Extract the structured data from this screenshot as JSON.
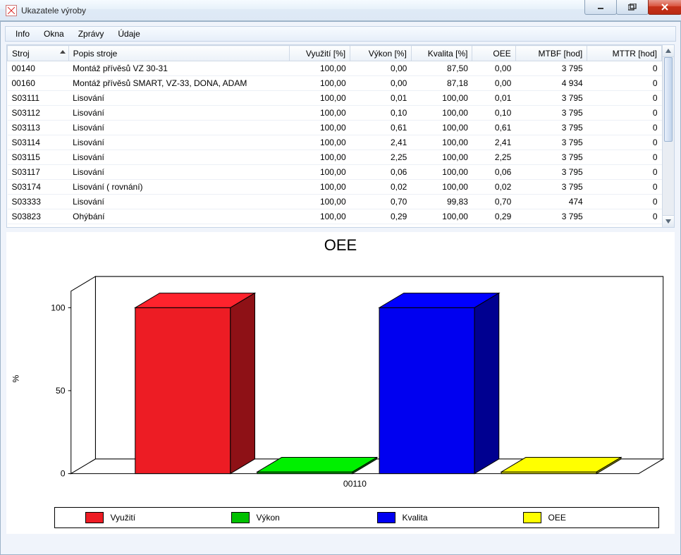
{
  "window": {
    "title": "Ukazatele výroby"
  },
  "menu": {
    "items": [
      "Info",
      "Okna",
      "Zprávy",
      "Údaje"
    ]
  },
  "table": {
    "columns": {
      "stroj": "Stroj",
      "popis": "Popis stroje",
      "vyuziti": "Využití [%]",
      "vykon": "Výkon [%]",
      "kvalita": "Kvalita [%]",
      "oee": "OEE",
      "mtbf": "MTBF [hod]",
      "mttr": "MTTR [hod]"
    },
    "rows": [
      {
        "stroj": "00140",
        "popis": "Montáž přívěsů VZ 30-31",
        "vyuziti": "100,00",
        "vykon": "0,00",
        "kvalita": "87,50",
        "oee": "0,00",
        "mtbf": "3 795",
        "mttr": "0"
      },
      {
        "stroj": "00160",
        "popis": "Montáž přívěsů SMART, VZ-33, DONA, ADAM",
        "vyuziti": "100,00",
        "vykon": "0,00",
        "kvalita": "87,18",
        "oee": "0,00",
        "mtbf": "4 934",
        "mttr": "0"
      },
      {
        "stroj": "S03111",
        "popis": "Lisování",
        "vyuziti": "100,00",
        "vykon": "0,01",
        "kvalita": "100,00",
        "oee": "0,01",
        "mtbf": "3 795",
        "mttr": "0"
      },
      {
        "stroj": "S03112",
        "popis": "Lisování",
        "vyuziti": "100,00",
        "vykon": "0,10",
        "kvalita": "100,00",
        "oee": "0,10",
        "mtbf": "3 795",
        "mttr": "0"
      },
      {
        "stroj": "S03113",
        "popis": "Lisování",
        "vyuziti": "100,00",
        "vykon": "0,61",
        "kvalita": "100,00",
        "oee": "0,61",
        "mtbf": "3 795",
        "mttr": "0"
      },
      {
        "stroj": "S03114",
        "popis": "Lisování",
        "vyuziti": "100,00",
        "vykon": "2,41",
        "kvalita": "100,00",
        "oee": "2,41",
        "mtbf": "3 795",
        "mttr": "0"
      },
      {
        "stroj": "S03115",
        "popis": "Lisování",
        "vyuziti": "100,00",
        "vykon": "2,25",
        "kvalita": "100,00",
        "oee": "2,25",
        "mtbf": "3 795",
        "mttr": "0"
      },
      {
        "stroj": "S03117",
        "popis": "Lisování",
        "vyuziti": "100,00",
        "vykon": "0,06",
        "kvalita": "100,00",
        "oee": "0,06",
        "mtbf": "3 795",
        "mttr": "0"
      },
      {
        "stroj": "S03174",
        "popis": "Lisování ( rovnání)",
        "vyuziti": "100,00",
        "vykon": "0,02",
        "kvalita": "100,00",
        "oee": "0,02",
        "mtbf": "3 795",
        "mttr": "0"
      },
      {
        "stroj": "S03333",
        "popis": "Lisování",
        "vyuziti": "100,00",
        "vykon": "0,70",
        "kvalita": "99,83",
        "oee": "0,70",
        "mtbf": "474",
        "mttr": "0"
      },
      {
        "stroj": "S03823",
        "popis": "Ohýbání",
        "vyuziti": "100,00",
        "vykon": "0,29",
        "kvalita": "100,00",
        "oee": "0,29",
        "mtbf": "3 795",
        "mttr": "0"
      }
    ]
  },
  "chart_data": {
    "type": "bar",
    "title": "OEE",
    "ylabel": "%",
    "xlabel": "00110",
    "ylim": [
      0,
      110
    ],
    "yticks": [
      0,
      50,
      100
    ],
    "categories": [
      "00110"
    ],
    "series": [
      {
        "name": "Využití",
        "color": "#ed1c24",
        "values": [
          100
        ]
      },
      {
        "name": "Výkon",
        "color": "#00c000",
        "values": [
          1
        ]
      },
      {
        "name": "Kvalita",
        "color": "#0000f0",
        "values": [
          100
        ]
      },
      {
        "name": "OEE",
        "color": "#ffff00",
        "values": [
          1
        ]
      }
    ]
  }
}
